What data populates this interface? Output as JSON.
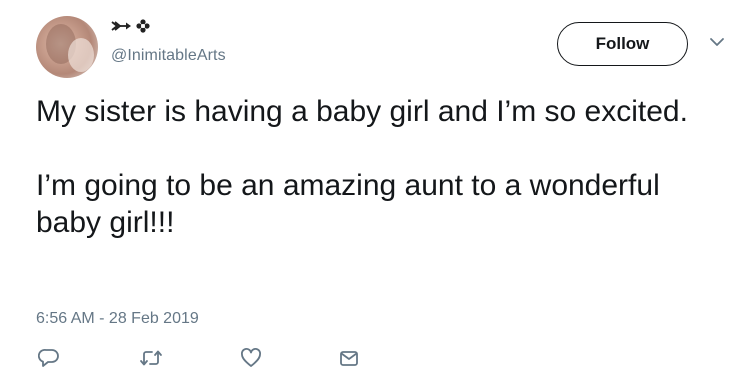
{
  "tweet": {
    "handle": "@InimitableArts",
    "follow_label": "Follow",
    "text_paragraphs": [
      "My sister is having a baby girl and I’m so excited.",
      "I’m going to be an amazing aunt to a wonderful baby girl!!!"
    ],
    "timestamp": "6:56 AM - 28 Feb 2019",
    "display_name_icons": [
      "arrow-emoji-icon",
      "flower-emoji-icon"
    ],
    "actions": [
      "reply-icon",
      "retweet-icon",
      "like-icon",
      "message-icon"
    ]
  },
  "colors": {
    "text": "#14171a",
    "secondary": "#657786",
    "icon": "#657786"
  }
}
